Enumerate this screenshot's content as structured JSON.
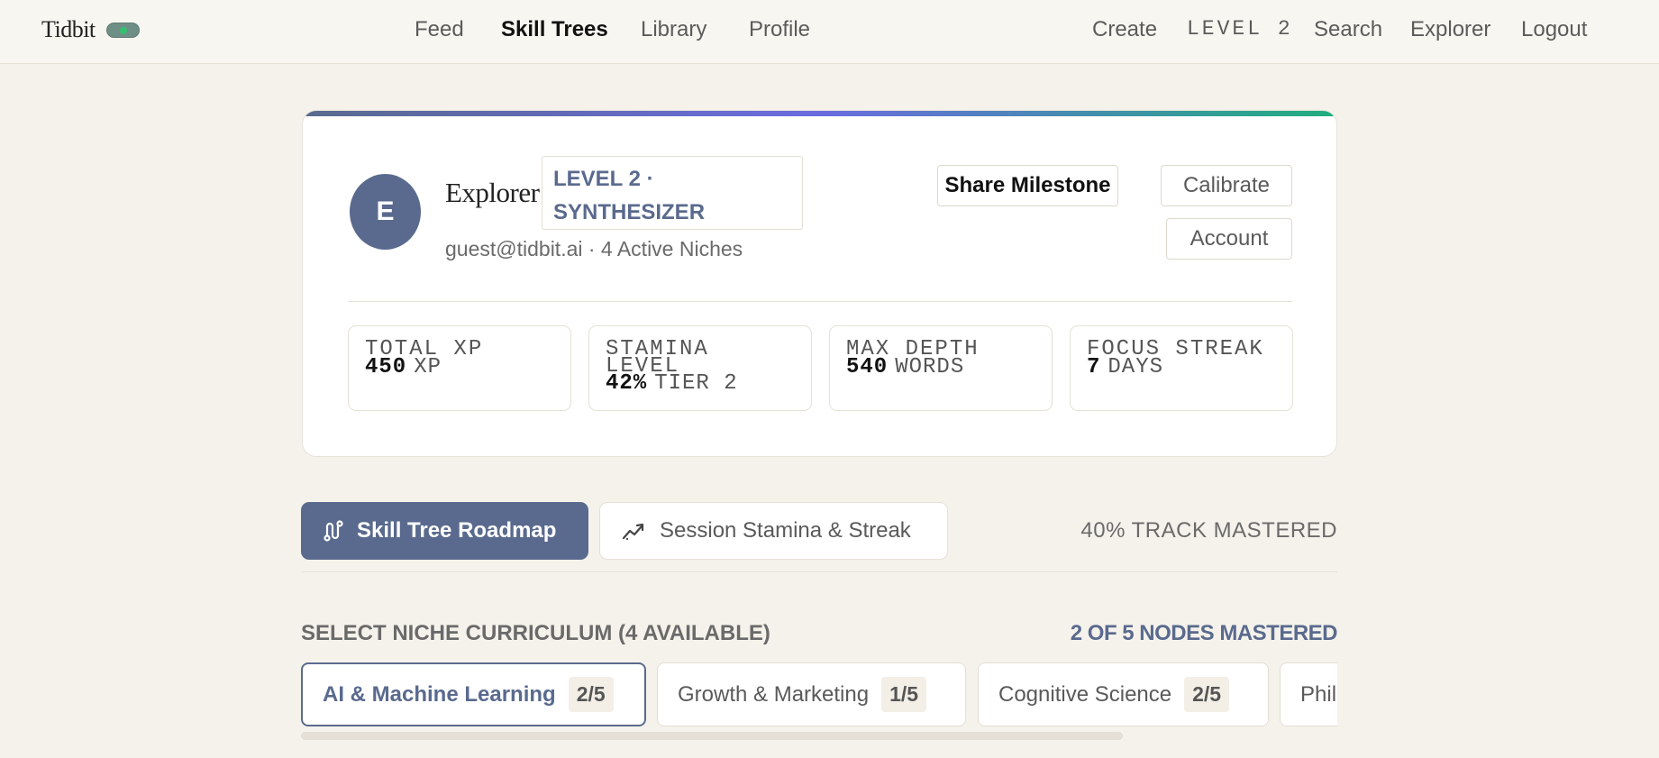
{
  "brand": "Tidbit",
  "nav": {
    "center": [
      "Feed",
      "Skill Trees",
      "Library",
      "Profile"
    ],
    "active": "Skill Trees",
    "right": {
      "create": "Create",
      "level": "LEVEL 2",
      "search": "Search",
      "explorer": "Explorer",
      "logout": "Logout"
    }
  },
  "profile": {
    "avatar_letter": "E",
    "name": "Explorer",
    "level_badge_line1": "LEVEL 2 ·",
    "level_badge_line2": "SYNTHESIZER",
    "subtitle": "guest@tidbit.ai · 4 Active Niches",
    "buttons": {
      "share": "Share Milestone",
      "calibrate": "Calibrate",
      "account": "Account"
    }
  },
  "stats": [
    {
      "label": "TOTAL XP",
      "value": "450",
      "unit": "XP"
    },
    {
      "label": "STAMINA LEVEL",
      "value": "42%",
      "unit": "TIER 2"
    },
    {
      "label": "MAX DEPTH",
      "value": "540",
      "unit": "WORDS"
    },
    {
      "label": "FOCUS STREAK",
      "value": "7",
      "unit": "DAYS"
    }
  ],
  "tabs": {
    "roadmap": "Skill Tree Roadmap",
    "stamina": "Session Stamina & Streak",
    "track_mastered": "40% TRACK MASTERED"
  },
  "curriculum": {
    "title": "SELECT NICHE CURRICULUM (4 AVAILABLE)",
    "nodes_mastered": "2 OF 5 NODES MASTERED",
    "niches": [
      {
        "name": "AI & Machine Learning",
        "count": "2/5"
      },
      {
        "name": "Growth & Marketing",
        "count": "1/5"
      },
      {
        "name": "Cognitive Science",
        "count": "2/5"
      },
      {
        "name": "Phil",
        "count": ""
      }
    ]
  },
  "colors": {
    "accent": "#5a6a8e",
    "background": "#f5f2eb",
    "toggle_on": "#35c16f"
  }
}
